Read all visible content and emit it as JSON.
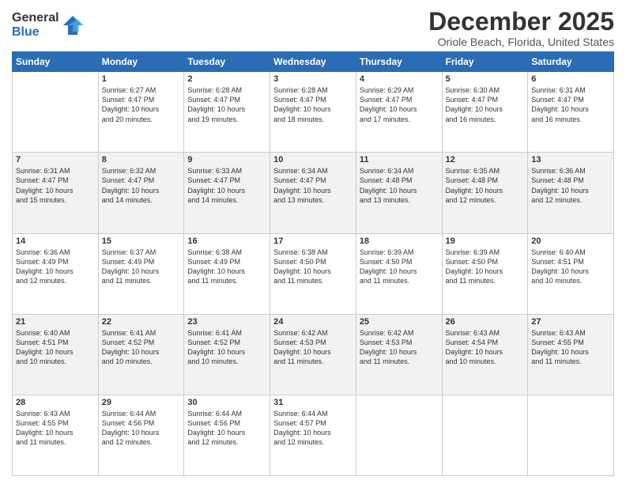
{
  "logo": {
    "general": "General",
    "blue": "Blue"
  },
  "header": {
    "title": "December 2025",
    "subtitle": "Oriole Beach, Florida, United States"
  },
  "weekdays": [
    "Sunday",
    "Monday",
    "Tuesday",
    "Wednesday",
    "Thursday",
    "Friday",
    "Saturday"
  ],
  "weeks": [
    [
      {
        "day": "",
        "info": ""
      },
      {
        "day": "1",
        "info": "Sunrise: 6:27 AM\nSunset: 4:47 PM\nDaylight: 10 hours\nand 20 minutes."
      },
      {
        "day": "2",
        "info": "Sunrise: 6:28 AM\nSunset: 4:47 PM\nDaylight: 10 hours\nand 19 minutes."
      },
      {
        "day": "3",
        "info": "Sunrise: 6:28 AM\nSunset: 4:47 PM\nDaylight: 10 hours\nand 18 minutes."
      },
      {
        "day": "4",
        "info": "Sunrise: 6:29 AM\nSunset: 4:47 PM\nDaylight: 10 hours\nand 17 minutes."
      },
      {
        "day": "5",
        "info": "Sunrise: 6:30 AM\nSunset: 4:47 PM\nDaylight: 10 hours\nand 16 minutes."
      },
      {
        "day": "6",
        "info": "Sunrise: 6:31 AM\nSunset: 4:47 PM\nDaylight: 10 hours\nand 16 minutes."
      }
    ],
    [
      {
        "day": "7",
        "info": "Sunrise: 6:31 AM\nSunset: 4:47 PM\nDaylight: 10 hours\nand 15 minutes."
      },
      {
        "day": "8",
        "info": "Sunrise: 6:32 AM\nSunset: 4:47 PM\nDaylight: 10 hours\nand 14 minutes."
      },
      {
        "day": "9",
        "info": "Sunrise: 6:33 AM\nSunset: 4:47 PM\nDaylight: 10 hours\nand 14 minutes."
      },
      {
        "day": "10",
        "info": "Sunrise: 6:34 AM\nSunset: 4:47 PM\nDaylight: 10 hours\nand 13 minutes."
      },
      {
        "day": "11",
        "info": "Sunrise: 6:34 AM\nSunset: 4:48 PM\nDaylight: 10 hours\nand 13 minutes."
      },
      {
        "day": "12",
        "info": "Sunrise: 6:35 AM\nSunset: 4:48 PM\nDaylight: 10 hours\nand 12 minutes."
      },
      {
        "day": "13",
        "info": "Sunrise: 6:36 AM\nSunset: 4:48 PM\nDaylight: 10 hours\nand 12 minutes."
      }
    ],
    [
      {
        "day": "14",
        "info": "Sunrise: 6:36 AM\nSunset: 4:49 PM\nDaylight: 10 hours\nand 12 minutes."
      },
      {
        "day": "15",
        "info": "Sunrise: 6:37 AM\nSunset: 4:49 PM\nDaylight: 10 hours\nand 11 minutes."
      },
      {
        "day": "16",
        "info": "Sunrise: 6:38 AM\nSunset: 4:49 PM\nDaylight: 10 hours\nand 11 minutes."
      },
      {
        "day": "17",
        "info": "Sunrise: 6:38 AM\nSunset: 4:50 PM\nDaylight: 10 hours\nand 11 minutes."
      },
      {
        "day": "18",
        "info": "Sunrise: 6:39 AM\nSunset: 4:50 PM\nDaylight: 10 hours\nand 11 minutes."
      },
      {
        "day": "19",
        "info": "Sunrise: 6:39 AM\nSunset: 4:50 PM\nDaylight: 10 hours\nand 11 minutes."
      },
      {
        "day": "20",
        "info": "Sunrise: 6:40 AM\nSunset: 4:51 PM\nDaylight: 10 hours\nand 10 minutes."
      }
    ],
    [
      {
        "day": "21",
        "info": "Sunrise: 6:40 AM\nSunset: 4:51 PM\nDaylight: 10 hours\nand 10 minutes."
      },
      {
        "day": "22",
        "info": "Sunrise: 6:41 AM\nSunset: 4:52 PM\nDaylight: 10 hours\nand 10 minutes."
      },
      {
        "day": "23",
        "info": "Sunrise: 6:41 AM\nSunset: 4:52 PM\nDaylight: 10 hours\nand 10 minutes."
      },
      {
        "day": "24",
        "info": "Sunrise: 6:42 AM\nSunset: 4:53 PM\nDaylight: 10 hours\nand 11 minutes."
      },
      {
        "day": "25",
        "info": "Sunrise: 6:42 AM\nSunset: 4:53 PM\nDaylight: 10 hours\nand 11 minutes."
      },
      {
        "day": "26",
        "info": "Sunrise: 6:43 AM\nSunset: 4:54 PM\nDaylight: 10 hours\nand 10 minutes."
      },
      {
        "day": "27",
        "info": "Sunrise: 6:43 AM\nSunset: 4:55 PM\nDaylight: 10 hours\nand 11 minutes."
      }
    ],
    [
      {
        "day": "28",
        "info": "Sunrise: 6:43 AM\nSunset: 4:55 PM\nDaylight: 10 hours\nand 11 minutes."
      },
      {
        "day": "29",
        "info": "Sunrise: 6:44 AM\nSunset: 4:56 PM\nDaylight: 10 hours\nand 12 minutes."
      },
      {
        "day": "30",
        "info": "Sunrise: 6:44 AM\nSunset: 4:56 PM\nDaylight: 10 hours\nand 12 minutes."
      },
      {
        "day": "31",
        "info": "Sunrise: 6:44 AM\nSunset: 4:57 PM\nDaylight: 10 hours\nand 12 minutes."
      },
      {
        "day": "",
        "info": ""
      },
      {
        "day": "",
        "info": ""
      },
      {
        "day": "",
        "info": ""
      }
    ]
  ]
}
